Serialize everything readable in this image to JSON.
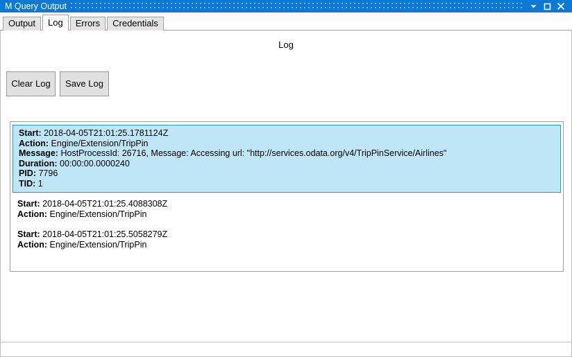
{
  "window": {
    "title": "M Query Output",
    "accent_color": "#0b7ad4",
    "controls": [
      {
        "name": "minimize-button",
        "glyph": "minimize"
      },
      {
        "name": "maximize-button",
        "glyph": "maximize"
      },
      {
        "name": "close-button",
        "glyph": "close"
      }
    ]
  },
  "tabs": [
    {
      "label": "Output",
      "active": false
    },
    {
      "label": "Log",
      "active": true
    },
    {
      "label": "Errors",
      "active": false
    },
    {
      "label": "Credentials",
      "active": false
    }
  ],
  "page": {
    "heading": "Log",
    "selection_fill": "#bfe6f7",
    "selection_border": "#1b9ad6"
  },
  "toolbar": {
    "clear_log_label": "Clear Log",
    "save_log_label": "Save Log"
  },
  "log": {
    "entries": [
      {
        "selected": true,
        "lines": [
          {
            "key": "Start:",
            "value": "2018-04-05T21:01:25.1781124Z"
          },
          {
            "key": "Action:",
            "value": "Engine/Extension/TripPin"
          },
          {
            "key": "Message:",
            "value": "HostProcessId: 26716, Message: Accessing url: \"http://services.odata.org/v4/TripPinService/Airlines\""
          },
          {
            "key": "Duration:",
            "value": "00:00:00.0000240"
          },
          {
            "key": "PID:",
            "value": "7796"
          },
          {
            "key": "TID:",
            "value": "1"
          }
        ]
      },
      {
        "selected": false,
        "lines": [
          {
            "key": "Start:",
            "value": "2018-04-05T21:01:25.4088308Z"
          },
          {
            "key": "Action:",
            "value": "Engine/Extension/TripPin"
          }
        ]
      },
      {
        "selected": false,
        "lines": [
          {
            "key": "Start:",
            "value": "2018-04-05T21:01:25.5058279Z"
          },
          {
            "key": "Action:",
            "value": "Engine/Extension/TripPin"
          }
        ]
      }
    ]
  },
  "statusbar": {
    "text": ""
  }
}
